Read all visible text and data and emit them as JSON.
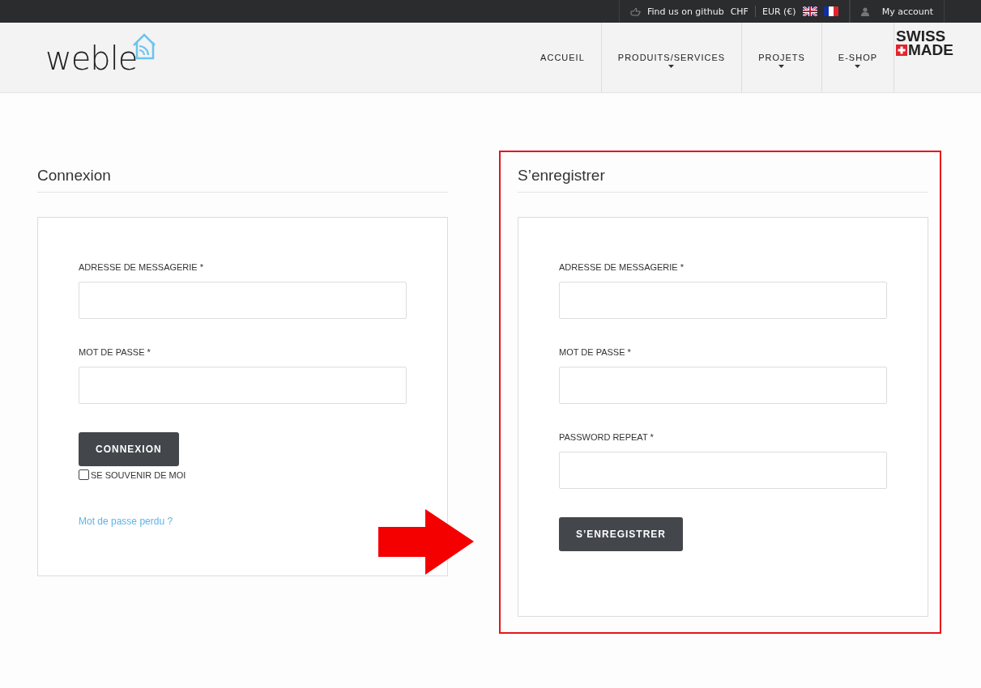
{
  "topbar": {
    "github": "Find us on github",
    "currencies": [
      "CHF",
      "EUR (€)"
    ],
    "languages": [
      {
        "kind": "uk"
      },
      {
        "kind": "fr"
      }
    ],
    "account": "My account"
  },
  "header": {
    "logo": "weble",
    "nav": [
      {
        "label": "ACCUEIL",
        "dropdown": false
      },
      {
        "label": "PRODUITS/SERVICES",
        "dropdown": true
      },
      {
        "label": "PROJETS",
        "dropdown": true
      },
      {
        "label": "E-SHOP",
        "dropdown": true
      }
    ],
    "badge": [
      "SWISS",
      "MADE"
    ]
  },
  "login": {
    "title": "Connexion",
    "fields": [
      {
        "label": "ADRESSE DE MESSAGERIE *"
      },
      {
        "label": "MOT DE PASSE *"
      }
    ],
    "button": "CONNEXION",
    "remember": {
      "label": "SE SOUVENIR DE MOI",
      "checked": false
    },
    "lost_link": "Mot de passe perdu ?"
  },
  "register": {
    "title": "S’enregistrer",
    "highlighted": true,
    "fields": [
      {
        "label": "ADRESSE DE MESSAGERIE *"
      },
      {
        "label": "MOT DE PASSE *"
      },
      {
        "label": "PASSWORD REPEAT *"
      }
    ],
    "button": "S’ENREGISTRER"
  },
  "annotation": {
    "arrow": true
  }
}
